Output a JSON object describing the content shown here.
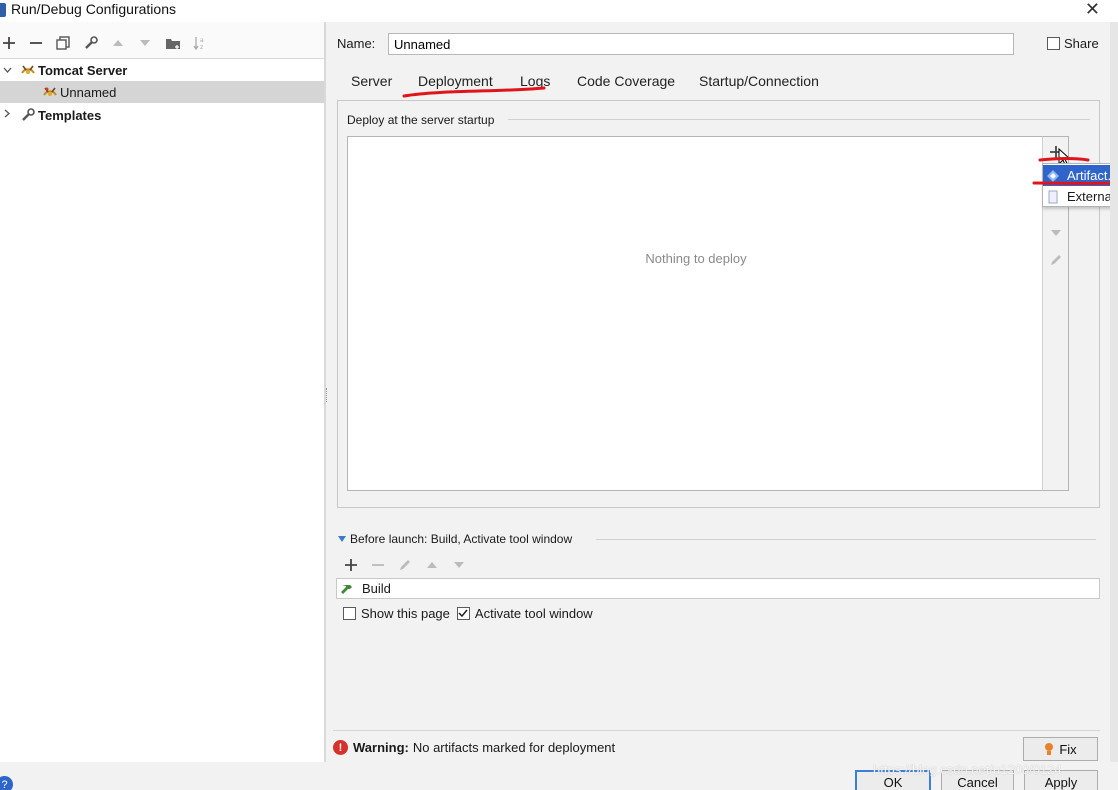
{
  "window": {
    "title": "Run/Debug Configurations"
  },
  "tree": {
    "items": [
      {
        "label": "Tomcat Server",
        "bold": true
      },
      {
        "label": "Unnamed",
        "selected": true
      },
      {
        "label": "Templates",
        "bold": true
      }
    ]
  },
  "name_field": {
    "label": "Name:",
    "value": "Unnamed"
  },
  "share": {
    "label": "Share",
    "checked": false
  },
  "tabs": [
    {
      "label": "Server"
    },
    {
      "label": "Deployment",
      "active": true
    },
    {
      "label": "Logs"
    },
    {
      "label": "Code Coverage"
    },
    {
      "label": "Startup/Connection"
    }
  ],
  "deployment": {
    "group_label": "Deploy at the server startup",
    "empty_text": "Nothing to deploy"
  },
  "add_popup": {
    "items": [
      {
        "label": "Artifact...",
        "selected": true
      },
      {
        "label": "External"
      }
    ]
  },
  "before_launch": {
    "label": "Before launch: Build, Activate tool window",
    "task": "Build",
    "show_page_label": "Show this page",
    "show_page_checked": false,
    "activate_label": "Activate tool window",
    "activate_checked": true
  },
  "warning": {
    "prefix": "Warning:",
    "text": "No artifacts marked for deployment"
  },
  "buttons": {
    "fix": "Fix",
    "ok": "OK",
    "cancel": "Cancel",
    "apply": "Apply"
  },
  "watermark": "https://blog.csdn.net/u1200/0124",
  "colors": {
    "selection": "#2f65ca",
    "annotation": "#e0141b",
    "warning": "#d6312b"
  }
}
